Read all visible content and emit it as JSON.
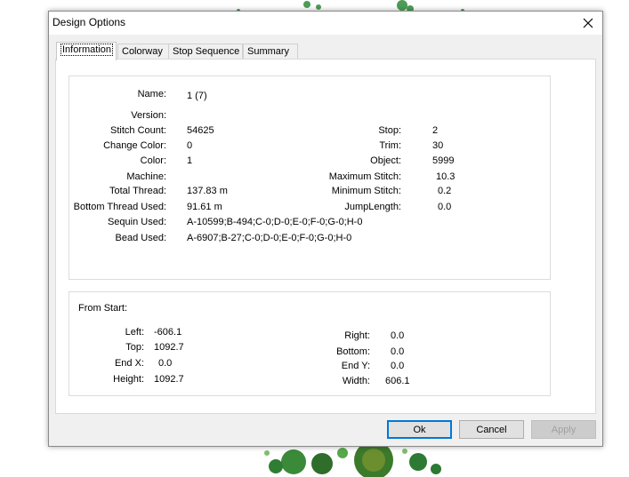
{
  "window": {
    "title": "Design Options"
  },
  "tabs": [
    {
      "label": "Information",
      "active": true
    },
    {
      "label": "Colorway",
      "active": false
    },
    {
      "label": "Stop Sequence",
      "active": false
    },
    {
      "label": "Summary",
      "active": false
    }
  ],
  "info": {
    "name": {
      "label": "Name:",
      "value": "1 (7)"
    },
    "version": {
      "label": "Version:",
      "value": ""
    },
    "stitch_count": {
      "label": "Stitch Count:",
      "value": "54625"
    },
    "change_color": {
      "label": "Change Color:",
      "value": "0"
    },
    "color": {
      "label": "Color:",
      "value": "1"
    },
    "machine": {
      "label": "Machine:",
      "value": ""
    },
    "total_thread": {
      "label": "Total Thread:",
      "value": "137.83 m"
    },
    "bottom_thread": {
      "label": "Bottom Thread Used:",
      "value": "91.61 m"
    },
    "sequin_used": {
      "label": "Sequin Used:",
      "value": "A-10599;B-494;C-0;D-0;E-0;F-0;G-0;H-0"
    },
    "bead_used": {
      "label": "Bead Used:",
      "value": "A-6907;B-27;C-0;D-0;E-0;F-0;G-0;H-0"
    },
    "stop": {
      "label": "Stop:",
      "value": "2"
    },
    "trim": {
      "label": "Trim:",
      "value": "30"
    },
    "object": {
      "label": "Object:",
      "value": "5999"
    },
    "max_stitch": {
      "label": "Maximum Stitch:",
      "value": "10.3"
    },
    "min_stitch": {
      "label": "Minimum Stitch:",
      "value": "0.2"
    },
    "jump_length": {
      "label": "JumpLength:",
      "value": "0.0"
    }
  },
  "from_start": {
    "heading": "From Start:",
    "left": {
      "label": "Left:",
      "value": "-606.1"
    },
    "top": {
      "label": "Top:",
      "value": "1092.7"
    },
    "end_x": {
      "label": "End X:",
      "value": "0.0"
    },
    "height": {
      "label": "Height:",
      "value": "1092.7"
    },
    "right": {
      "label": "Right:",
      "value": "0.0"
    },
    "bottom": {
      "label": "Bottom:",
      "value": "0.0"
    },
    "end_y": {
      "label": "End Y:",
      "value": "0.0"
    },
    "width": {
      "label": "Width:",
      "value": "606.1"
    }
  },
  "buttons": {
    "ok": "Ok",
    "cancel": "Cancel",
    "apply": "Apply"
  },
  "colors": {
    "accent": "#0078d7",
    "embroidery_green": "#2e8b3a"
  }
}
